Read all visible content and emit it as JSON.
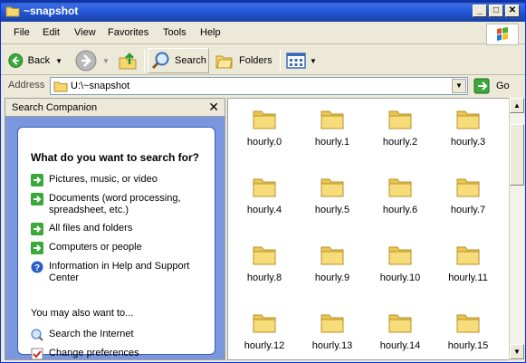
{
  "window": {
    "title": "~snapshot"
  },
  "menu": [
    "File",
    "Edit",
    "View",
    "Favorites",
    "Tools",
    "Help"
  ],
  "toolbar": {
    "back": "Back",
    "search": "Search",
    "folders": "Folders"
  },
  "address": {
    "label": "Address",
    "value": "U:\\~snapshot",
    "go": "Go"
  },
  "search_companion": {
    "title": "Search Companion",
    "question": "What do you want to search for?",
    "options": [
      "Pictures, music, or video",
      "Documents (word processing, spreadsheet, etc.)",
      "All files and folders",
      "Computers or people",
      "Information in Help and Support Center"
    ],
    "also_label": "You may also want to...",
    "also_options": [
      "Search the Internet",
      "Change preferences"
    ]
  },
  "files": [
    "hourly.0",
    "hourly.1",
    "hourly.2",
    "hourly.3",
    "hourly.4",
    "hourly.5",
    "hourly.6",
    "hourly.7",
    "hourly.8",
    "hourly.9",
    "hourly.10",
    "hourly.11",
    "hourly.12",
    "hourly.13",
    "hourly.14",
    "hourly.15"
  ]
}
